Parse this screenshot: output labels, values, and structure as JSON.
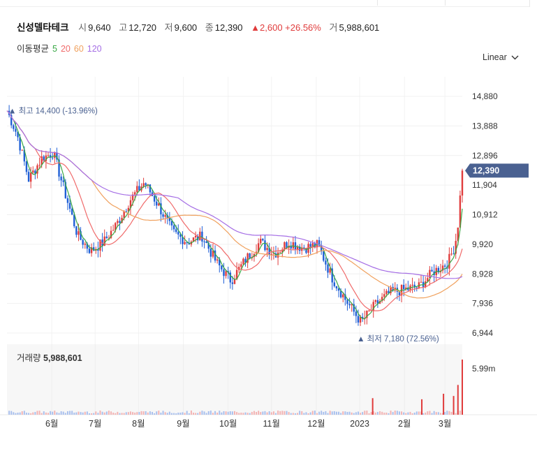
{
  "header": {
    "name": "신성델타테크",
    "open_label": "시",
    "open": "9,640",
    "high_label": "고",
    "high": "12,720",
    "low_label": "저",
    "low": "9,600",
    "close_label": "종",
    "close": "12,390",
    "change": "▲2,600 +26.56%",
    "volume_label": "거",
    "volume": "5,988,601"
  },
  "ma_legend": {
    "title": "이동평균",
    "ma5": "5",
    "ma20": "20",
    "ma60": "60",
    "ma120": "120"
  },
  "scale_toggle": "Linear",
  "volume_panel": {
    "label": "거래량",
    "value": "5,988,601",
    "axis_label": "5.99m"
  },
  "colors": {
    "up": "#e03c3c",
    "down": "#1f5fd6",
    "ma5": "#39a845",
    "ma20": "#f06a6a",
    "ma60": "#f0a15e",
    "ma120": "#a56ee5",
    "badge": "#4a6191"
  },
  "chart_data": {
    "type": "candlestick",
    "y_axis_ticks": [
      "14,880",
      "13,888",
      "12,896",
      "11,904",
      "10,912",
      "9,920",
      "8,928",
      "7,936",
      "6,944"
    ],
    "y_tick_values": [
      14880,
      13888,
      12896,
      11904,
      10912,
      9920,
      8928,
      7936,
      6944
    ],
    "ylim": [
      6944,
      14880
    ],
    "x_axis_labels": [
      "6월",
      "7월",
      "8월",
      "9월",
      "10월",
      "11월",
      "12월",
      "2023",
      "2월",
      "3월"
    ],
    "x_label_days": [
      12,
      42,
      72,
      103,
      134,
      164,
      195,
      225,
      256,
      284
    ],
    "x_range_days": [
      -19,
      296
    ],
    "last_price_badge": "12,390",
    "last_price": 12390,
    "max_label": "최고 14,400 (-13.96%)",
    "max_value": 14400,
    "min_label": "최저 7,180 (72.56%)",
    "min_value": 7180,
    "price_path": [
      [
        -19,
        14400
      ],
      [
        -12,
        13600
      ],
      [
        -4,
        12100
      ],
      [
        5,
        12800
      ],
      [
        13,
        13000
      ],
      [
        22,
        11500
      ],
      [
        30,
        10200
      ],
      [
        39,
        9700
      ],
      [
        48,
        10000
      ],
      [
        57,
        10600
      ],
      [
        66,
        11400
      ],
      [
        76,
        12000
      ],
      [
        86,
        11200
      ],
      [
        96,
        10300
      ],
      [
        106,
        10000
      ],
      [
        116,
        10200
      ],
      [
        126,
        9300
      ],
      [
        136,
        8700
      ],
      [
        146,
        9400
      ],
      [
        156,
        10000
      ],
      [
        166,
        9600
      ],
      [
        176,
        10000
      ],
      [
        186,
        9800
      ],
      [
        196,
        9900
      ],
      [
        206,
        8800
      ],
      [
        216,
        8000
      ],
      [
        226,
        7300
      ],
      [
        236,
        7900
      ],
      [
        246,
        8300
      ],
      [
        256,
        8400
      ],
      [
        266,
        8500
      ],
      [
        276,
        9000
      ],
      [
        286,
        9300
      ],
      [
        291,
        9900
      ],
      [
        293,
        10600
      ],
      [
        296,
        12390
      ]
    ],
    "volume_max": 5988601,
    "volume_spikes": [
      [
        234,
        0.3
      ],
      [
        268,
        0.28
      ],
      [
        283,
        0.38
      ],
      [
        290,
        0.34
      ],
      [
        293,
        0.54
      ],
      [
        296,
        1.0
      ]
    ]
  }
}
